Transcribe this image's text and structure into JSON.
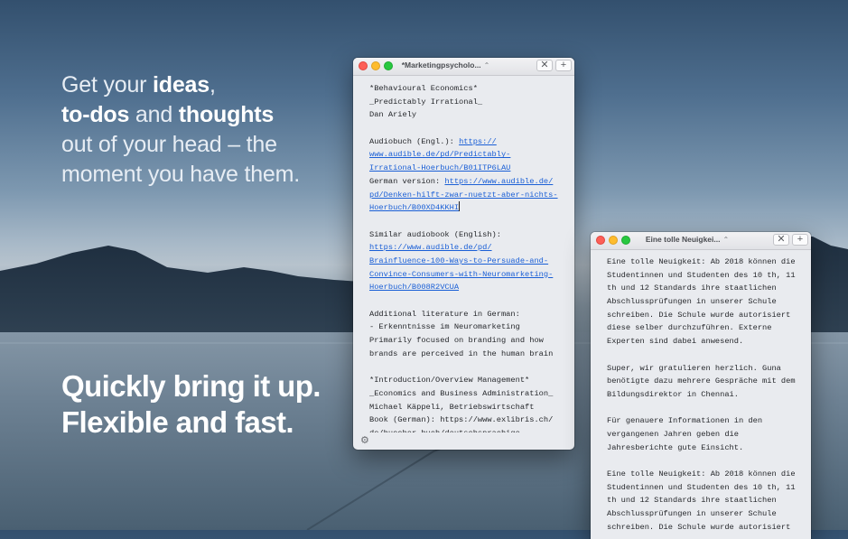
{
  "marketing": {
    "headline": {
      "line1": {
        "normal": "Get your ",
        "bold": "ideas",
        "tail": ","
      },
      "line2": {
        "bold1": "to-dos",
        "middle": " and ",
        "bold2": "thoughts"
      },
      "line3": "out of your head – the",
      "line4": "moment you have them."
    },
    "tagline": {
      "line1": "Quickly bring it up.",
      "line2": "Flexible and fast."
    }
  },
  "window1": {
    "title": "*Marketingpsycholo...",
    "updown_icon": "⌃",
    "close_label": "✕",
    "add_label": "+",
    "lines": [
      {
        "t": "*Behavioural Economics*"
      },
      {
        "t": "_Predictably Irrational_"
      },
      {
        "t": "Dan Ariely"
      },
      {
        "t": ""
      },
      {
        "t": "Audiobuch (Engl.): ",
        "link": "https://"
      },
      {
        "t": "",
        "link": "www.audible.de/pd/Predictably-"
      },
      {
        "t": "",
        "link": "Irrational-Hoerbuch/B01ITP6LAU"
      },
      {
        "t": "German version: ",
        "link": "https://www.audible.de/"
      },
      {
        "t": "",
        "link": "pd/Denken-hilft-zwar-nuetzt-aber-nichts-"
      },
      {
        "t": "",
        "link": "Hoerbuch/B00XD4KKHI",
        "cursor": true
      },
      {
        "t": ""
      },
      {
        "t": "Similar audiobook (English):"
      },
      {
        "t": "",
        "link": "https://www.audible.de/pd/"
      },
      {
        "t": "",
        "link": "Brainfluence-100-Ways-to-Persuade-and-"
      },
      {
        "t": "",
        "link": "Convince-Consumers-with-Neuromarketing-"
      },
      {
        "t": "",
        "link": "Hoerbuch/B008R2VCUA"
      },
      {
        "t": ""
      },
      {
        "t": "Additional literature in German:"
      },
      {
        "t": "- Erkenntnisse im Neuromarketing"
      },
      {
        "t": "Primarily focused on branding and how"
      },
      {
        "t": "brands are perceived in the human brain"
      },
      {
        "t": ""
      },
      {
        "t": "*Introduction/Overview Management*"
      },
      {
        "t": "_Economics and Business Administration_"
      },
      {
        "t": "Michael Käppeli, Betriebswirtschaft"
      },
      {
        "t": "Book (German): https://www.exlibris.ch/"
      },
      {
        "t": "de/buecher-buch/deutschsprachige-"
      }
    ],
    "settings_icon": "⚙"
  },
  "window2": {
    "title": "Eine tolle Neuigkei...",
    "updown_icon": "⌃",
    "close_label": "✕",
    "add_label": "+",
    "lines": [
      "Eine tolle Neuigkeit: Ab 2018 können die",
      "Studentinnen und Studenten des 10 th, 11",
      "th und 12 Standards ihre staatlichen",
      "Abschlussprüfungen in unserer Schule",
      "schreiben. Die Schule wurde autorisiert",
      "diese selber durchzuführen. Externe",
      "Experten sind dabei anwesend.",
      "",
      "Super, wir gratulieren herzlich. Guna",
      "benötigte dazu mehrere Gespräche mit dem",
      "Bildungsdirektor in Chennai.",
      "",
      "Für genauere Informationen in den",
      "vergangenen Jahren geben die",
      "Jahresberichte gute Einsicht.",
      "",
      "Eine tolle Neuigkeit: Ab 2018 können die",
      "Studentinnen und Studenten des 10 th, 11",
      "th und 12 Standards ihre staatlichen",
      "Abschlussprüfungen in unserer Schule",
      "schreiben. Die Schule wurde autorisiert"
    ]
  }
}
